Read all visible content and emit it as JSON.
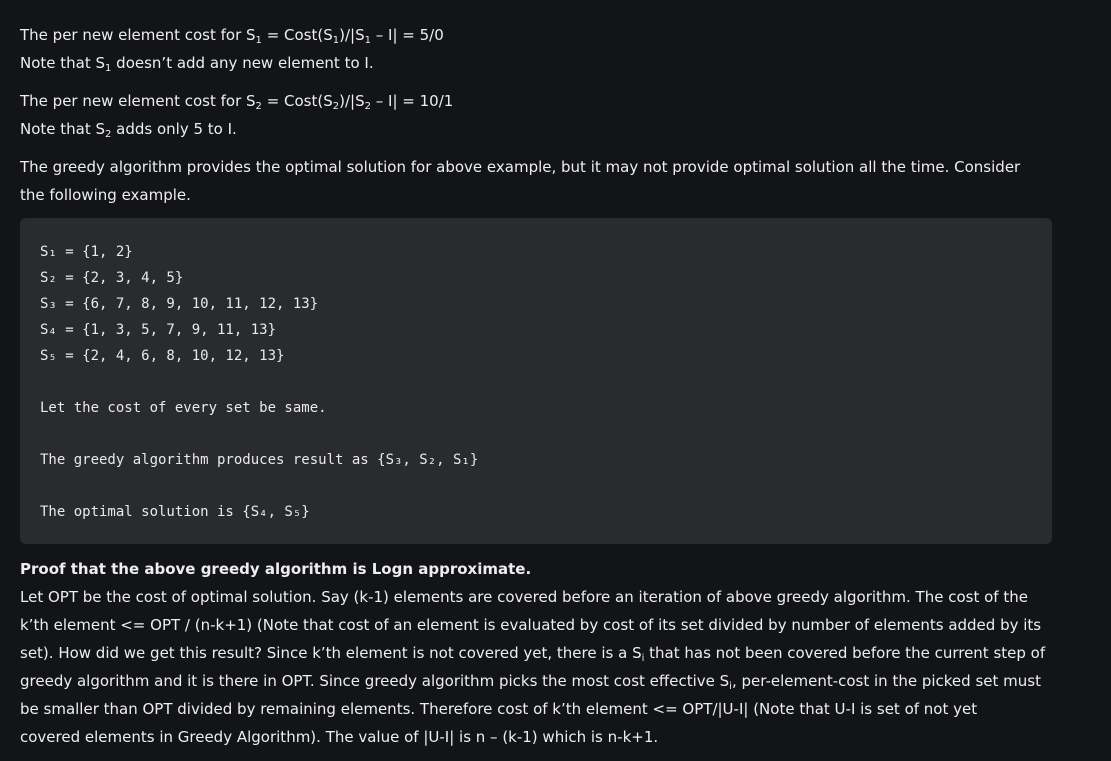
{
  "p1": {
    "line1": [
      "The per new element cost for S",
      "1",
      " = Cost(S",
      "1",
      ")/|S",
      "1",
      " – I| = 5/0"
    ],
    "line2": [
      "Note that S",
      "1",
      " doesn’t add any new element to I."
    ]
  },
  "p2": {
    "line1": [
      "The per new element cost for S",
      "2",
      " = Cost(S",
      "2",
      ")/|S",
      "2",
      " – I| = 10/1"
    ],
    "line2": [
      "Note that S",
      "2",
      " adds only 5 to I."
    ]
  },
  "p3": {
    "line1": "The greedy algorithm provides the optimal solution for above example, but it may not provide optimal solution all the time. Consider",
    "line2": "the following example."
  },
  "code": {
    "lines": [
      "S₁ = {1, 2}",
      "S₂ = {2, 3, 4, 5}",
      "S₃ = {6, 7, 8, 9, 10, 11, 12, 13}",
      "S₄ = {1, 3, 5, 7, 9, 11, 13}",
      "S₅ = {2, 4, 6, 8, 10, 12, 13}",
      "Let the cost of every set be same.",
      "The greedy algorithm produces result as {S₃, S₂, S₁}",
      "The optimal solution is {S₄, S₅}"
    ]
  },
  "proof": {
    "heading": "Proof that the above greedy algorithm is Logn approximate.",
    "lines": [
      "Let OPT be the cost of optimal solution. Say (k-1) elements are covered before an iteration of above greedy algorithm. The cost of the",
      "k’th element <= OPT / (n-k+1) (Note that cost of an element is evaluated by cost of its set divided by number of elements added by its",
      [
        "set). How did we get this result? Since k’th element is not covered yet, there is a S",
        "i",
        " that has not been covered before the current step of"
      ],
      [
        "greedy algorithm and it is there in OPT. Since greedy algorithm picks the most cost effective S",
        "i",
        ", per-element-cost in the picked set must"
      ],
      "be smaller than OPT divided by remaining elements. Therefore cost of k’th element <= OPT/|U-I| (Note that U-I is set of not yet",
      "covered elements in Greedy Algorithm). The value of |U-I| is n – (k-1) which is n-k+1."
    ]
  }
}
